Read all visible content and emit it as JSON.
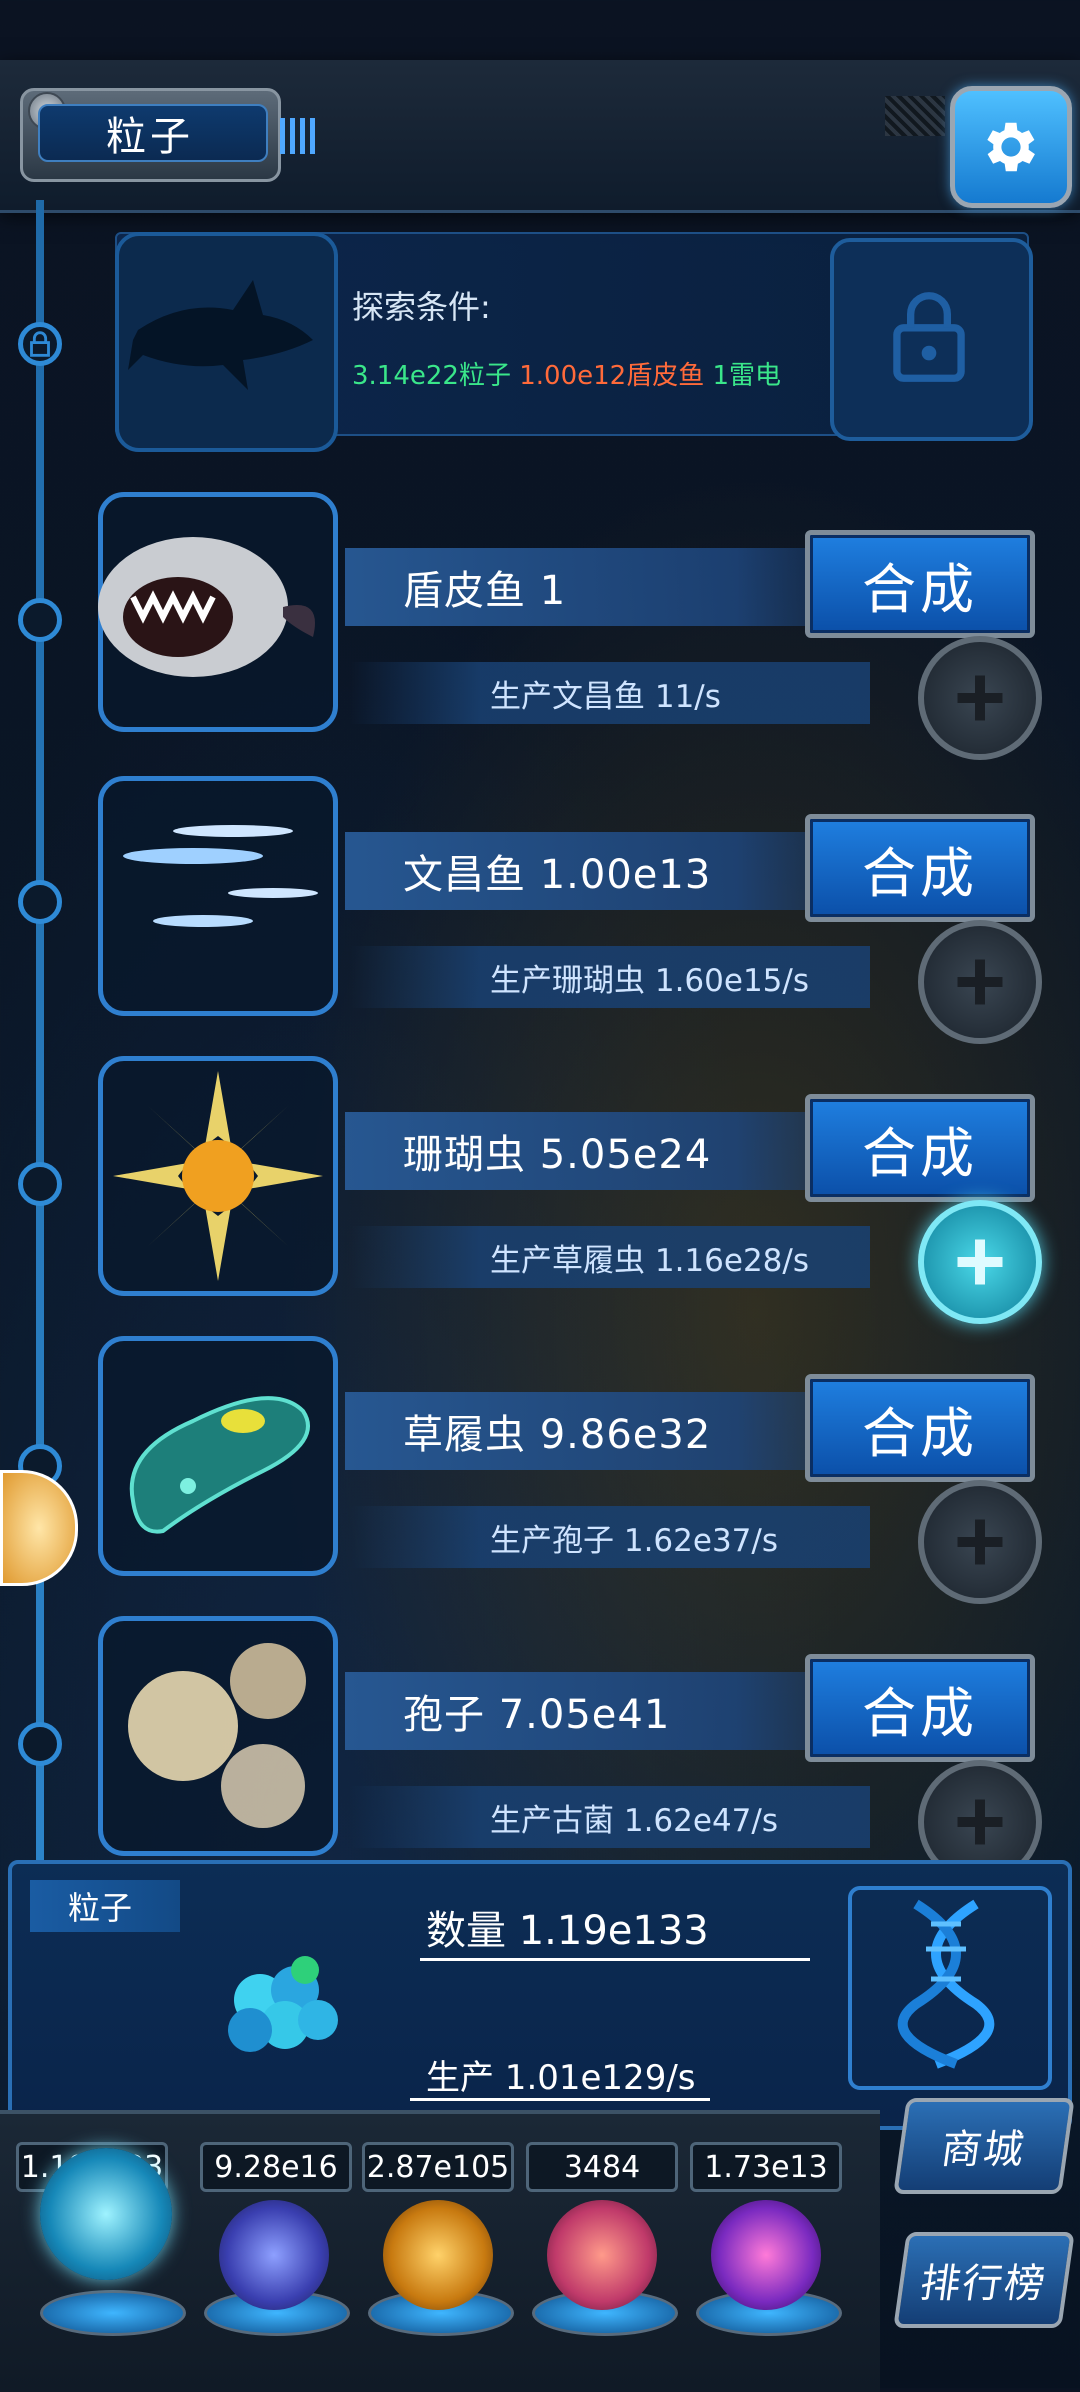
{
  "header": {
    "title": "粒子"
  },
  "explore": {
    "label": "探索条件:",
    "conditions": [
      {
        "text": "3.14e22粒子",
        "color": "#3ae68a"
      },
      {
        "text": "1.00e12盾皮鱼",
        "color": "#ff6a3a"
      },
      {
        "text": "1雷电",
        "color": "#3ae68a"
      }
    ]
  },
  "creatures": [
    {
      "name": "盾皮鱼 1",
      "produce": "生产文昌鱼 11/s",
      "button": "合成",
      "plus_active": false
    },
    {
      "name": "文昌鱼 1.00e13",
      "produce": "生产珊瑚虫 1.60e15/s",
      "button": "合成",
      "plus_active": false
    },
    {
      "name": "珊瑚虫 5.05e24",
      "produce": "生产草履虫 1.16e28/s",
      "button": "合成",
      "plus_active": true
    },
    {
      "name": "草履虫 9.86e32",
      "produce": "生产孢子 1.62e37/s",
      "button": "合成",
      "plus_active": false
    },
    {
      "name": "孢子 7.05e41",
      "produce": "生产古菌 1.62e47/s",
      "button": "合成",
      "plus_active": false
    }
  ],
  "particle": {
    "tag": "粒子",
    "quantity": "数量 1.19e133",
    "production": "生产 1.01e129/s"
  },
  "currencies": [
    "1.19e133",
    "9.28e16",
    "2.87e105",
    "3484",
    "1.73e13"
  ],
  "side_buttons": {
    "shop": "商城",
    "ranking": "排行榜"
  }
}
